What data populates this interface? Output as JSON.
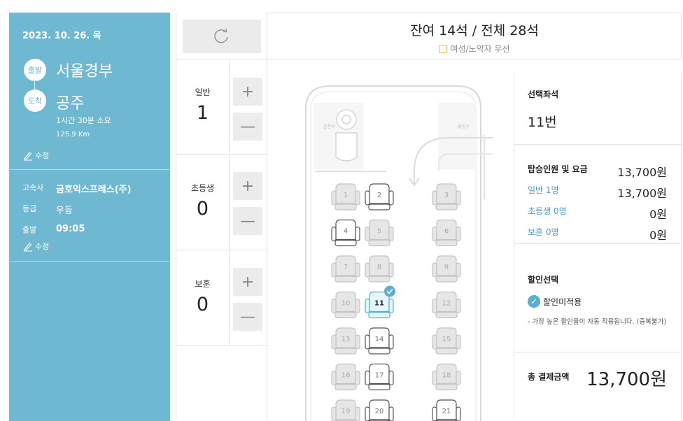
{
  "trip": {
    "date": "2023. 10. 26. 목",
    "departure_badge": "출발",
    "departure": "서울경부",
    "arrival_badge": "도착",
    "arrival": "공주",
    "duration": "1시간 30분 소요",
    "distance": "125.9 Km",
    "edit_label": "수정"
  },
  "bus_info": {
    "company_label": "고속사",
    "company": "금호익스프레스(주)",
    "grade_label": "등급",
    "grade": "우등",
    "depart_label": "출발",
    "depart_time": "09:05",
    "edit_label": "수정"
  },
  "passengers": [
    {
      "label": "일반",
      "count": "1"
    },
    {
      "label": "초등생",
      "count": "0"
    },
    {
      "label": "보훈",
      "count": "0"
    }
  ],
  "stepper": {
    "plus": "+",
    "minus": "—"
  },
  "header": {
    "remain_text": "잔여 14석 / 전체 28석",
    "preference_label": "여성/노약자 우선"
  },
  "bus": {
    "driver_label": "운전석",
    "door_label": "출입구",
    "seats": [
      "1",
      "2",
      "3",
      "4",
      "5",
      "6",
      "7",
      "8",
      "9",
      "10",
      "11",
      "12",
      "13",
      "14",
      "15",
      "16",
      "17",
      "18",
      "19",
      "20",
      "21"
    ],
    "available_seats": [
      "2",
      "4",
      "11",
      "14",
      "17",
      "20",
      "21"
    ],
    "selected_seat": "11"
  },
  "summary": {
    "selected_title": "선택좌석",
    "selected_value": "11번",
    "fare_title": "탑승인원 및 요금",
    "fare_total": "13,700원",
    "rows": [
      {
        "label": "일반 1명",
        "value": "13,700원"
      },
      {
        "label": "초등생 0명",
        "value": "0원"
      },
      {
        "label": "보훈 0명",
        "value": "0원"
      }
    ],
    "discount_title": "할인선택",
    "discount_option": "할인미적용",
    "discount_note": "- 가장 높은 할인율이 자동 적용됩니다. (중복불가)",
    "total_title": "총 결제금액",
    "total_value": "13,700원"
  },
  "colors": {
    "panel": "#6fb8d2",
    "selected_seat": "#5aaed0",
    "preference_box": "#f0b64a"
  }
}
